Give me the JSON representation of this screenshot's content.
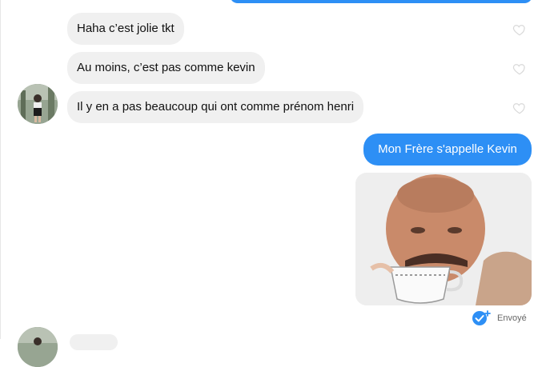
{
  "messages": {
    "incoming": [
      {
        "text": "Haha c’est jolie tkt"
      },
      {
        "text": "Au moins, c’est pas comme kevin"
      },
      {
        "text": "Il y en a pas beaucoup qui ont comme prénom henri"
      }
    ],
    "outgoing": [
      {
        "text": "Mon Frère s'appelle Kevin"
      }
    ]
  },
  "status": {
    "label": "Envoyé"
  },
  "icons": {
    "like": "heart-outline-icon",
    "seen": "sent-check-icon",
    "gif": "gif-image"
  },
  "colors": {
    "accent": "#2d8ff5",
    "incoming_bubble": "#f0f0f0",
    "heart_outline": "#d9d9d9"
  }
}
